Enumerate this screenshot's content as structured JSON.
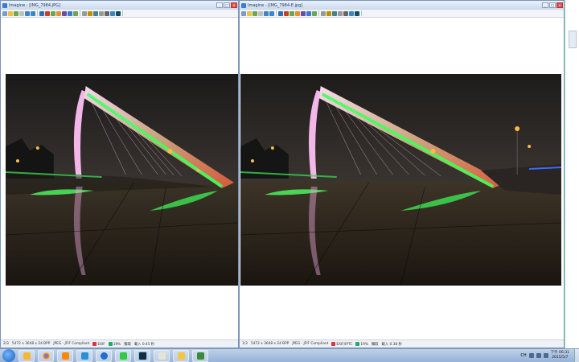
{
  "left_window": {
    "title": "Imagine - [IMG_7984.JPG]",
    "status": {
      "index": "2/3",
      "dims": "5472 x 3648 x 24 BPP",
      "format": "JPEG - JFIF Compliant",
      "meta": "EXIF",
      "zoom": "19%",
      "label": "獨取",
      "time": "載入 0.45 秒"
    }
  },
  "right_window": {
    "title": "Imagine - [IMG_7984-E.jpg]",
    "status": {
      "index": "1/3",
      "dims": "5472 x 3648 x 24 BPP",
      "format": "JPEG - JFIF Compliant",
      "meta": "EXIF/IPTC",
      "zoom": "19%",
      "label": "獨取",
      "time": "載入 0.38 秒"
    }
  },
  "taskbar": {
    "apps": [
      "start-orb",
      "internet-explorer",
      "chrome",
      "media-player",
      "network",
      "ie-blue",
      "line",
      "lightroom",
      "notepad",
      "folder",
      "game"
    ],
    "clock_time": "下午 06:31",
    "clock_date": "2015/5/7",
    "tray_text": "CH"
  },
  "colors": {
    "title_gradient_top": "#eaf1fb",
    "green_light": "#3dff5a",
    "pink_arch": "#f3b6e8",
    "sky": "#262423"
  }
}
